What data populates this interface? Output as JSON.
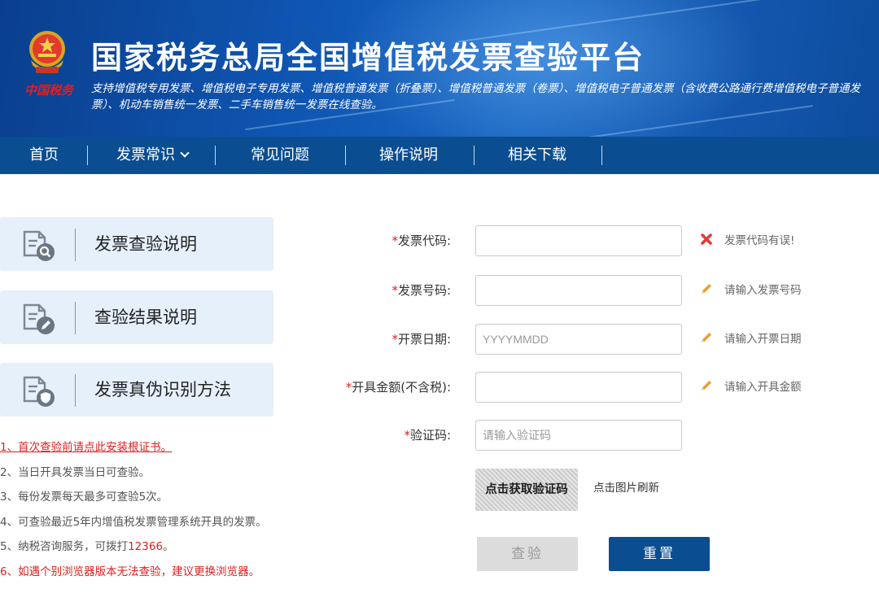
{
  "header": {
    "brand_text": "中国税务",
    "title": "国家税务总局全国增值税发票查验平台",
    "subtitle": "支持增值税专用发票、增值税电子专用发票、增值税普通发票（折叠票）、增值税普通发票（卷票）、增值税电子普通发票（含收费公路通行费增值税电子普通发票）、机动车销售统一发票、二手车销售统一发票在线查验。"
  },
  "nav": {
    "items": [
      "首页",
      "发票常识",
      "常见问题",
      "操作说明",
      "相关下载"
    ]
  },
  "side": {
    "cards": [
      {
        "label": "发票查验说明",
        "icon": "doc-search-icon"
      },
      {
        "label": "查验结果说明",
        "icon": "doc-edit-icon"
      },
      {
        "label": "发票真伪识别方法",
        "icon": "doc-shield-icon"
      }
    ],
    "notes": [
      "1、首次查验前请点此安装根证书。",
      "2、当日开具发票当日可查验。",
      "3、每份发票每天最多可查验5次。",
      "4、可查验最近5年内增值税发票管理系统开具的发票。",
      "5、纳税咨询服务，可拨打",
      "12366",
      "。",
      "6、如遇个别浏览器版本无法查验，建议更换浏览器。"
    ]
  },
  "form": {
    "invoice_code": {
      "label": "发票代码:",
      "value": "",
      "placeholder": "",
      "hint": "发票代码有误!",
      "hint_icon": "error-x-icon"
    },
    "invoice_number": {
      "label": "发票号码:",
      "value": "",
      "placeholder": "",
      "hint": "请输入发票号码",
      "hint_icon": "pencil-icon"
    },
    "issue_date": {
      "label": "开票日期:",
      "value": "",
      "placeholder": "YYYYMMDD",
      "hint": "请输入开票日期",
      "hint_icon": "pencil-icon"
    },
    "amount": {
      "label": "开具金额(不含税):",
      "value": "",
      "placeholder": "",
      "hint": "请输入开具金额",
      "hint_icon": "pencil-icon"
    },
    "captcha": {
      "label": "验证码:",
      "value": "",
      "placeholder": "请输入验证码"
    },
    "captcha_image_text": "点击获取验证码",
    "captcha_hint": "点击图片刷新",
    "required_mark": "*",
    "check_button": "查验",
    "reset_button": "重置"
  },
  "colors": {
    "nav_bg": "#0b4d91",
    "header_bg": "#0f56b3",
    "required": "#e02020",
    "card_bg": "#e6f0fb",
    "error_icon": "#e03a3a",
    "pencil_icon": "#e8a030"
  }
}
